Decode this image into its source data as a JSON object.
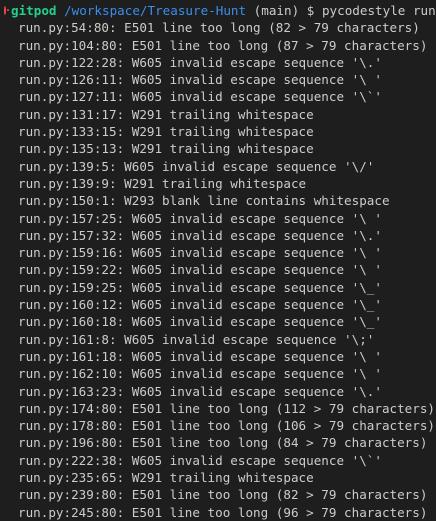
{
  "prompt": {
    "user": "gitpod",
    "path": "/workspace/Treasure-Hunt",
    "branch": "(main)",
    "symbol": "$",
    "command": "pycodestyle run.py"
  },
  "output_lines": [
    "run.py:54:80: E501 line too long (82 > 79 characters)",
    "run.py:104:80: E501 line too long (87 > 79 characters)",
    "run.py:122:28: W605 invalid escape sequence '\\.'",
    "run.py:126:11: W605 invalid escape sequence '\\ '",
    "run.py:127:11: W605 invalid escape sequence '\\`'",
    "run.py:131:17: W291 trailing whitespace",
    "run.py:133:15: W291 trailing whitespace",
    "run.py:135:13: W291 trailing whitespace",
    "run.py:139:5: W605 invalid escape sequence '\\/'",
    "run.py:139:9: W291 trailing whitespace",
    "run.py:150:1: W293 blank line contains whitespace",
    "run.py:157:25: W605 invalid escape sequence '\\ '",
    "run.py:157:32: W605 invalid escape sequence '\\.'",
    "run.py:159:16: W605 invalid escape sequence '\\ '",
    "run.py:159:22: W605 invalid escape sequence '\\ '",
    "run.py:159:25: W605 invalid escape sequence '\\_'",
    "run.py:160:12: W605 invalid escape sequence '\\_'",
    "run.py:160:18: W605 invalid escape sequence '\\_'",
    "run.py:161:8: W605 invalid escape sequence '\\;'",
    "run.py:161:18: W605 invalid escape sequence '\\ '",
    "run.py:162:10: W605 invalid escape sequence '\\ '",
    "run.py:163:23: W605 invalid escape sequence '\\.'",
    "run.py:174:80: E501 line too long (112 > 79 characters)",
    "run.py:178:80: E501 line too long (106 > 79 characters)",
    "run.py:196:80: E501 line too long (84 > 79 characters)",
    "run.py:222:38: W605 invalid escape sequence '\\`'",
    "run.py:235:65: W291 trailing whitespace",
    "run.py:239:80: E501 line too long (82 > 79 characters)",
    "run.py:245:80: E501 line too long (96 > 79 characters)"
  ],
  "colors": {
    "background": "#1e1e1e",
    "text": "#cccccc",
    "user": "#23d18b",
    "path": "#3b8eea",
    "status_error": "#f14c4c"
  },
  "icons": {
    "status": "error-circle-icon"
  }
}
